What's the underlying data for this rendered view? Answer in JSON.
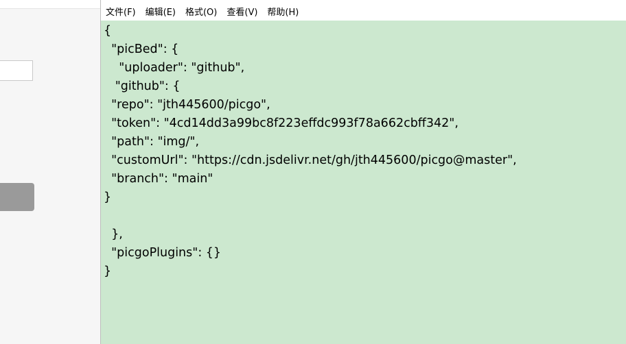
{
  "menubar": {
    "items": [
      "文件(F)",
      "编辑(E)",
      "格式(O)",
      "查看(V)",
      "帮助(H)"
    ]
  },
  "editor": {
    "lines": [
      "{",
      "  \"picBed\": {",
      "    \"uploader\": \"github\",",
      "   \"github\": {",
      "  \"repo\": \"jth445600/picgo\",",
      "  \"token\": \"4cd14dd3a99bc8f223effdc993f78a662cbff342\",",
      "  \"path\": \"img/\",",
      "  \"customUrl\": \"https://cdn.jsdelivr.net/gh/jth445600/picgo@master\",",
      "  \"branch\": \"main\"",
      "}",
      "",
      "  },",
      "  \"picgoPlugins\": {}",
      "}"
    ]
  },
  "colors": {
    "editor_background": "#cce8cf",
    "background_button": "#9a9a9a"
  }
}
